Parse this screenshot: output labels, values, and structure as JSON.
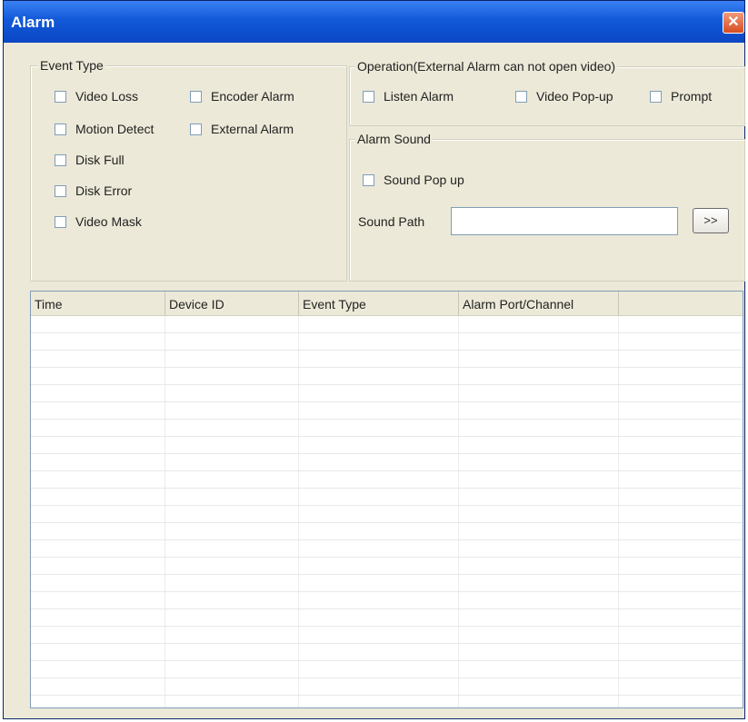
{
  "window": {
    "title": "Alarm",
    "close_glyph": "✕"
  },
  "event_type": {
    "legend": "Event Type",
    "items": [
      {
        "label": "Video Loss"
      },
      {
        "label": "Encoder Alarm"
      },
      {
        "label": "Motion Detect"
      },
      {
        "label": "External Alarm"
      },
      {
        "label": "Disk Full"
      },
      {
        "label": "Disk Error"
      },
      {
        "label": "Video Mask"
      }
    ]
  },
  "operation": {
    "legend": "Operation(External Alarm can not open video)",
    "items": [
      {
        "label": "Listen Alarm"
      },
      {
        "label": "Video Pop-up"
      },
      {
        "label": "Prompt"
      }
    ]
  },
  "alarm_sound": {
    "legend": "Alarm Sound",
    "sound_popup_label": "Sound Pop up",
    "sound_path_label": "Sound Path",
    "sound_path_value": "",
    "browse_label": ">>"
  },
  "alarm_list": {
    "columns": [
      "Time",
      "Device ID",
      "Event Type",
      "Alarm Port/Channel",
      ""
    ],
    "rows": []
  },
  "colors": {
    "titlebar": "#0a46c4",
    "dialog_bg": "#ece9d8"
  }
}
